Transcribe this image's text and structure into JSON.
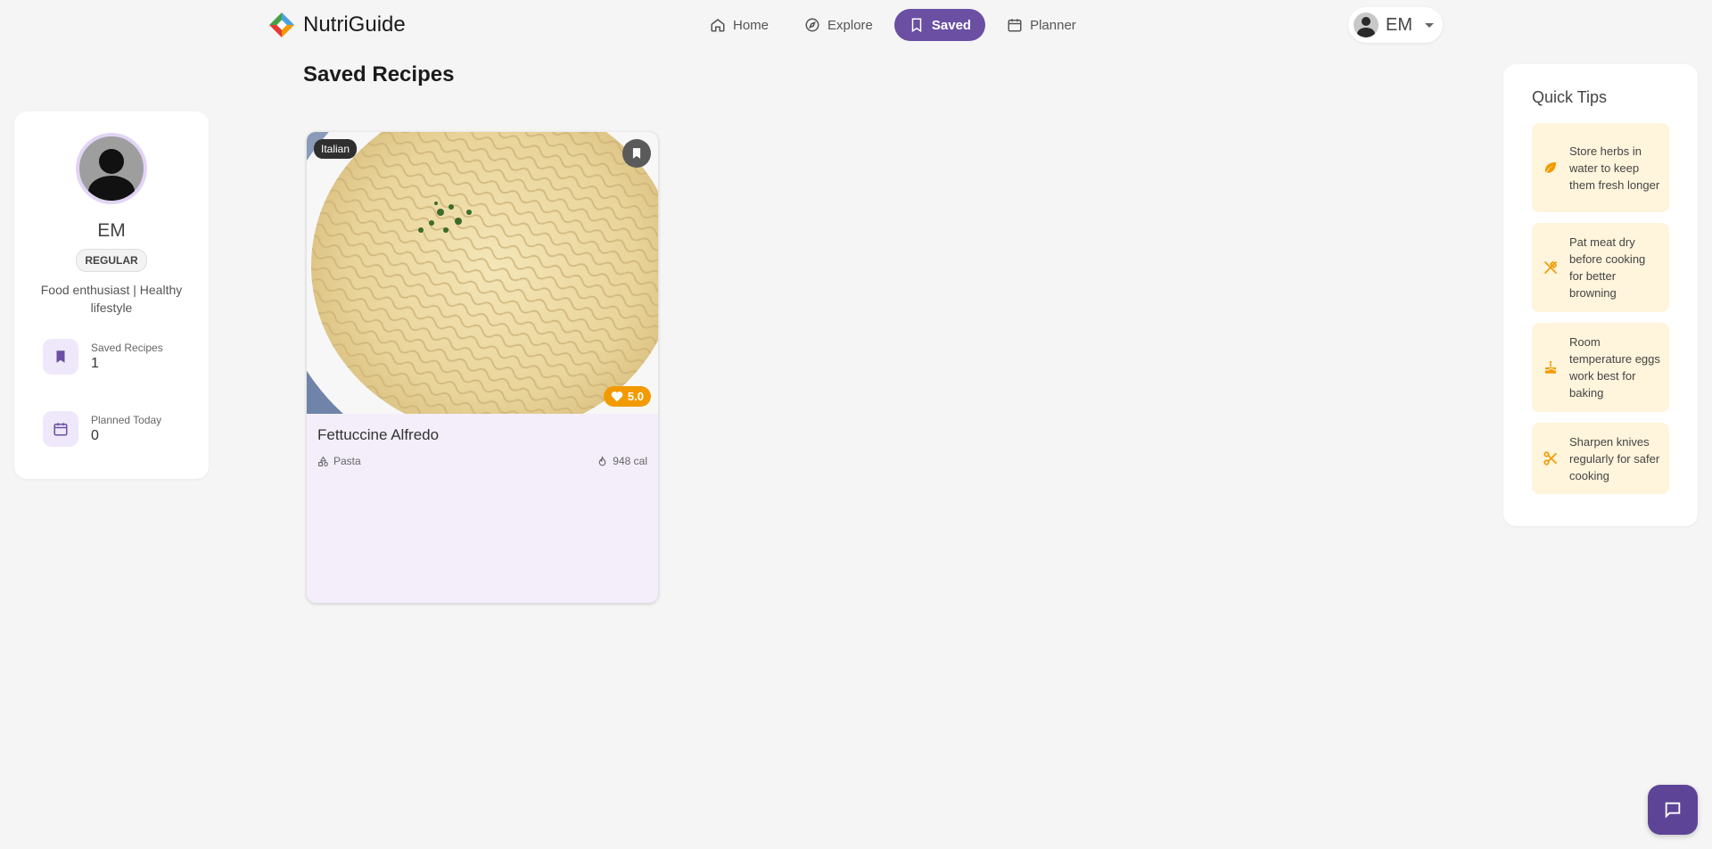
{
  "header": {
    "brand": "NutriGuide",
    "nav": [
      {
        "label": "Home",
        "icon": "home-icon",
        "active": false
      },
      {
        "label": "Explore",
        "icon": "compass-icon",
        "active": false
      },
      {
        "label": "Saved",
        "icon": "bookmark-icon",
        "active": true
      },
      {
        "label": "Planner",
        "icon": "calendar-icon",
        "active": false
      }
    ],
    "user_initials": "EM"
  },
  "profile": {
    "name": "EM",
    "badge": "REGULAR",
    "bio": "Food enthusiast | Healthy lifestyle",
    "stats": [
      {
        "label": "Saved Recipes",
        "value": "1",
        "icon": "bookmark-icon"
      },
      {
        "label": "Planned Today",
        "value": "0",
        "icon": "calendar-icon"
      }
    ]
  },
  "main": {
    "title": "Saved Recipes",
    "recipes": [
      {
        "name": "Fettuccine Alfredo",
        "cuisine": "Italian",
        "rating": "5.0",
        "category": "Pasta",
        "calories": "948 cal"
      }
    ]
  },
  "tips": {
    "title": "Quick Tips",
    "items": [
      {
        "text": "Store herbs in water to keep them fresh longer",
        "icon": "leaf-icon"
      },
      {
        "text": "Pat meat dry before cooking for better browning",
        "icon": "utensils-icon"
      },
      {
        "text": "Room temperature eggs work best for baking",
        "icon": "cake-icon"
      },
      {
        "text": "Sharpen knives regularly for safer cooking",
        "icon": "scissors-icon"
      }
    ]
  },
  "colors": {
    "accent": "#6a4fa3",
    "tip_bg": "#fff4dc",
    "tip_icon": "#f29a00",
    "rating_bg": "#f29a00"
  }
}
